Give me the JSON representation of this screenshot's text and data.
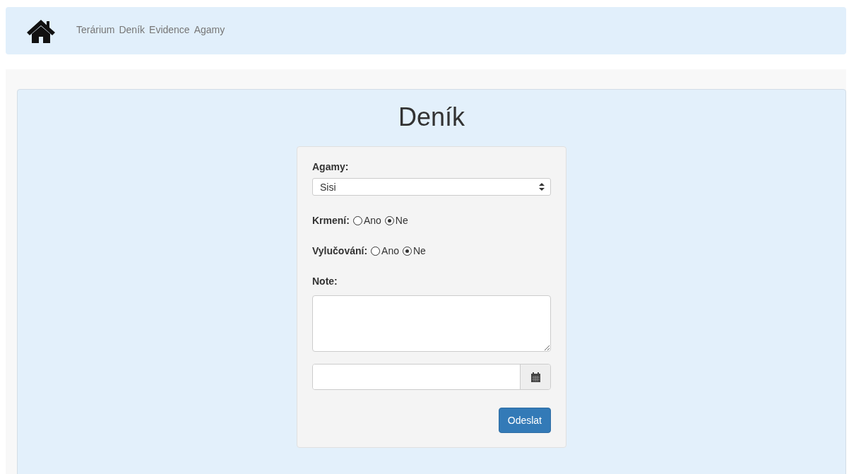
{
  "nav": {
    "links": [
      "Terárium",
      "Deník",
      "Evidence",
      "Agamy"
    ]
  },
  "title": "Deník",
  "form": {
    "select": {
      "label": "Agamy:",
      "value": "Sisi"
    },
    "radio_groups": [
      {
        "label": "Krmení:",
        "options": [
          {
            "label": "Ano",
            "selected": false
          },
          {
            "label": "Ne",
            "selected": true
          }
        ]
      },
      {
        "label": "Vylučování:",
        "options": [
          {
            "label": "Ano",
            "selected": false
          },
          {
            "label": "Ne",
            "selected": true
          }
        ]
      }
    ],
    "note": {
      "label": "Note:"
    },
    "submit": "Odeslat"
  }
}
